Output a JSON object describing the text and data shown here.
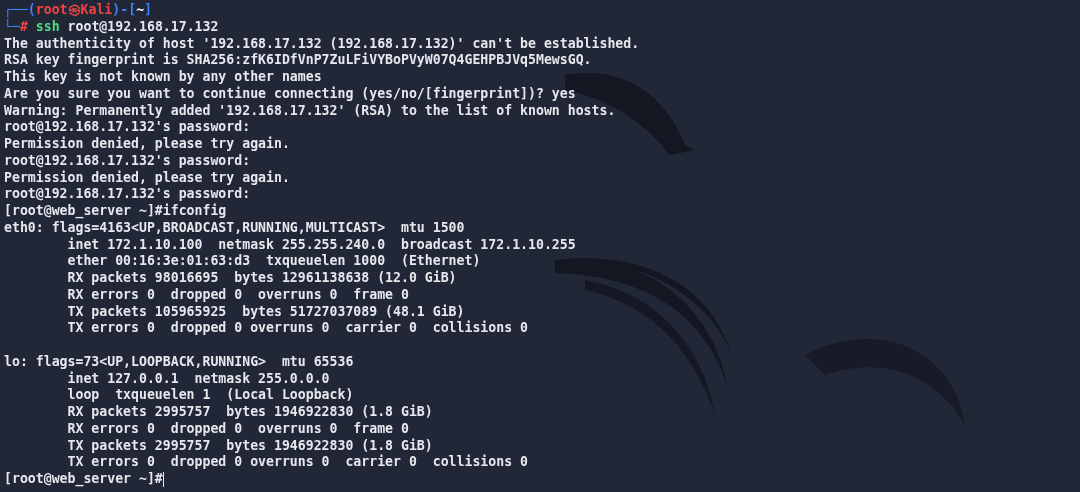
{
  "prompt": {
    "corner_top": "┌──(",
    "user_host": "root㉿Kali",
    "dir_open": ")-[",
    "dir": "~",
    "dir_close": "]",
    "corner_bottom": "└─",
    "symbol": "#",
    "command": "ssh",
    "args": "root@192.168.17.132"
  },
  "blocks": [
    {
      "lines": [
        "The authenticity of host '192.168.17.132 (192.168.17.132)' can't be established.",
        "RSA key fingerprint is SHA256:zfK6IDfVnP7ZuLFiVYBoPVyW07Q4GEHPBJVq5MewsGQ.",
        "This key is not known by any other names",
        "Are you sure you want to continue connecting (yes/no/[fingerprint])? yes",
        "Warning: Permanently added '192.168.17.132' (RSA) to the list of known hosts.",
        "root@192.168.17.132's password:",
        "Permission denied, please try again.",
        "root@192.168.17.132's password:",
        "Permission denied, please try again.",
        "root@192.168.17.132's password:",
        "[root@web_server ~]#ifconfig",
        "eth0: flags=4163<UP,BROADCAST,RUNNING,MULTICAST>  mtu 1500",
        "        inet 172.1.10.100  netmask 255.255.240.0  broadcast 172.1.10.255",
        "        ether 00:16:3e:01:63:d3  txqueuelen 1000  (Ethernet)",
        "        RX packets 98016695  bytes 12961138638 (12.0 GiB)",
        "        RX errors 0  dropped 0  overruns 0  frame 0",
        "        TX packets 105965925  bytes 51727037089 (48.1 GiB)",
        "        TX errors 0  dropped 0 overruns 0  carrier 0  collisions 0"
      ]
    },
    {
      "lines": [
        "lo: flags=73<UP,LOOPBACK,RUNNING>  mtu 65536",
        "        inet 127.0.0.1  netmask 255.0.0.0",
        "        loop  txqueuelen 1  (Local Loopback)",
        "        RX packets 2995757  bytes 1946922830 (1.8 GiB)",
        "        RX errors 0  dropped 0  overruns 0  frame 0",
        "        TX packets 2995757  bytes 1946922830 (1.8 GiB)",
        "        TX errors 0  dropped 0 overruns 0  carrier 0  collisions 0"
      ]
    }
  ],
  "current_prompt": "[root@web_server ~]#"
}
